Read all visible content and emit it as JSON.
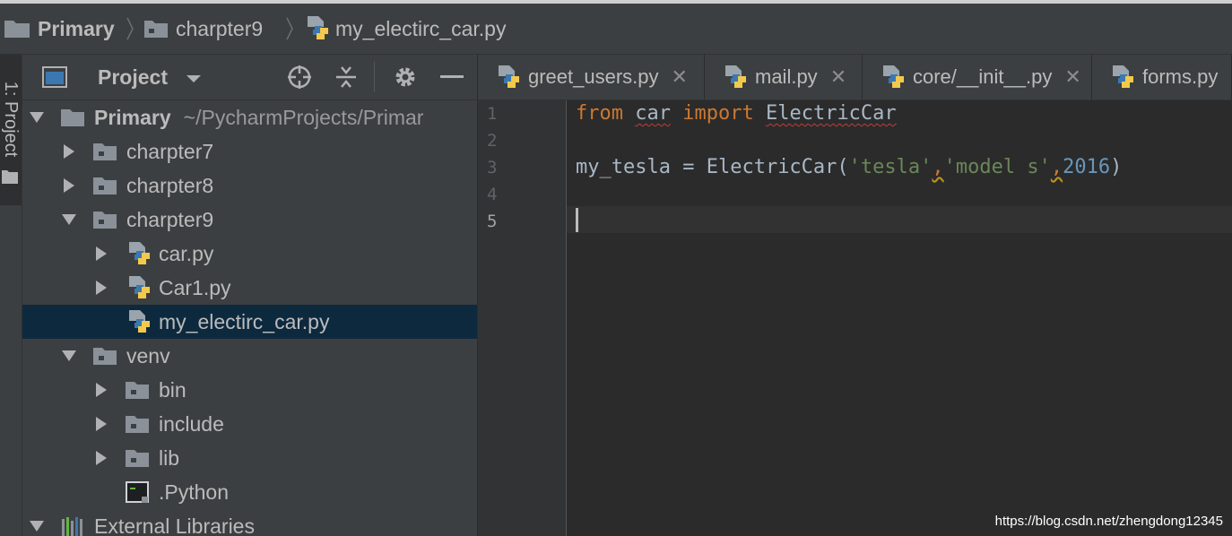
{
  "breadcrumb": {
    "items": [
      "Primary",
      "charpter9",
      "my_electirc_car.py"
    ]
  },
  "sidebar_stripe": {
    "label": "1: Project"
  },
  "project_panel": {
    "title": "Project",
    "tree": [
      {
        "label": "Primary",
        "path": "~/PycharmProjects/Primar",
        "expanded": true
      },
      {
        "label": "charpter7",
        "expanded": false
      },
      {
        "label": "charpter8",
        "expanded": false
      },
      {
        "label": "charpter9",
        "expanded": true
      },
      {
        "label": "car.py",
        "expanded": false
      },
      {
        "label": "Car1.py",
        "expanded": false
      },
      {
        "label": "my_electirc_car.py",
        "selected": true
      },
      {
        "label": "venv",
        "expanded": true
      },
      {
        "label": "bin",
        "expanded": false
      },
      {
        "label": "include",
        "expanded": false
      },
      {
        "label": "lib",
        "expanded": false
      },
      {
        "label": ".Python"
      },
      {
        "label": "External Libraries",
        "expanded": true
      }
    ]
  },
  "editor": {
    "tabs": [
      {
        "label": "greet_users.py"
      },
      {
        "label": "mail.py"
      },
      {
        "label": "core/__init__.py"
      },
      {
        "label": "forms.py"
      }
    ],
    "line_numbers": [
      "1",
      "2",
      "3",
      "4",
      "5"
    ],
    "code": {
      "line1": {
        "kw_from": "from",
        "module": "car",
        "kw_import": "import",
        "name": "ElectricCar"
      },
      "line3": {
        "var": "my_tesla",
        "eq": " = ",
        "call": "ElectricCar(",
        "arg1": "'tesla'",
        "comma1": ",",
        "arg2": "'model s'",
        "comma2": ",",
        "arg3": "2016",
        "close": ")"
      }
    }
  },
  "watermark": "https://blog.csdn.net/zhengdong12345",
  "colors": {
    "keyword": "#cc7832",
    "string": "#6a8759",
    "number": "#6897bb",
    "selection": "#0d293e"
  }
}
